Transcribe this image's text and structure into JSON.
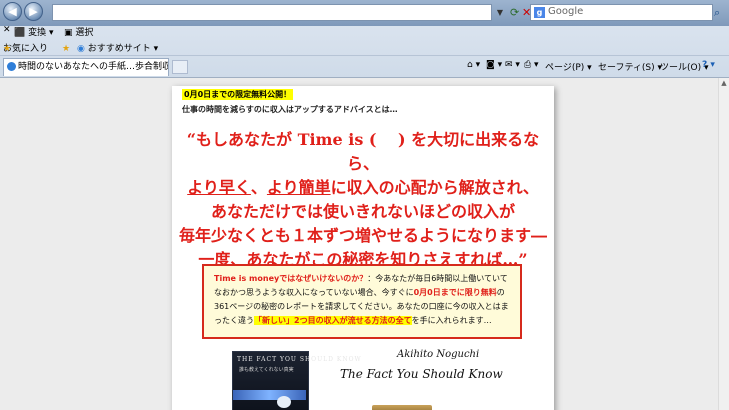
{
  "browser": {
    "address": "",
    "search_placeholder": "Google",
    "search_engine_icon": "google-icon",
    "menu": {
      "convert": "変換",
      "select": "選択"
    },
    "favorites": {
      "favorites_label": "お気に入り",
      "suggested_sites": "おすすめサイト"
    },
    "tab_title": "時間のないあなたへの手紙…歩合制収入源とは？",
    "commands": {
      "page": "ページ(P)",
      "safety": "セーフティ(S)",
      "tools": "ツール(O)"
    }
  },
  "page": {
    "highlight_line": "0月0日までの限定無料公開！",
    "subtitle": "仕事の時間を減らすのに収入はアップするアドバイスとは…",
    "headline": {
      "l1": "“もしあなたが Time is (　 ) を大切に出来るなら、",
      "l2a": "より早く",
      "l2b": "、",
      "l2c": "より簡単",
      "l2d": "に収入の心配から解放され、",
      "l3": "あなただけでは使いきれないほどの収入が",
      "l4": "毎年少なくとも１本ずつ増やせるようになります―",
      "l5a": "一度、あなたがこの",
      "l5b": "秘密",
      "l5c": "を知りさえすれば…”"
    },
    "box": {
      "q": "Time is moneyではなぜいけないのか？",
      "t1": "：今あなたが毎日6時間以上働いていてなおかつ思うような収入になっていない場合、今すぐに",
      "red1": "0月0日までに限り無料",
      "t2": "の361ページの秘密のレポートを請求してください。あなたの口座に今の収入とはまったく違う",
      "hl": "「新しい」2つ目の収入が流せる方法の全て",
      "t3": "を手に入れられます…"
    },
    "book": {
      "title": "THE FACT YOU SHOULD KNOW",
      "subtitle": "誰も教えてくれない真実"
    },
    "signature1": "Akihito Noguchi",
    "signature2": "The Fact You Should Know"
  }
}
